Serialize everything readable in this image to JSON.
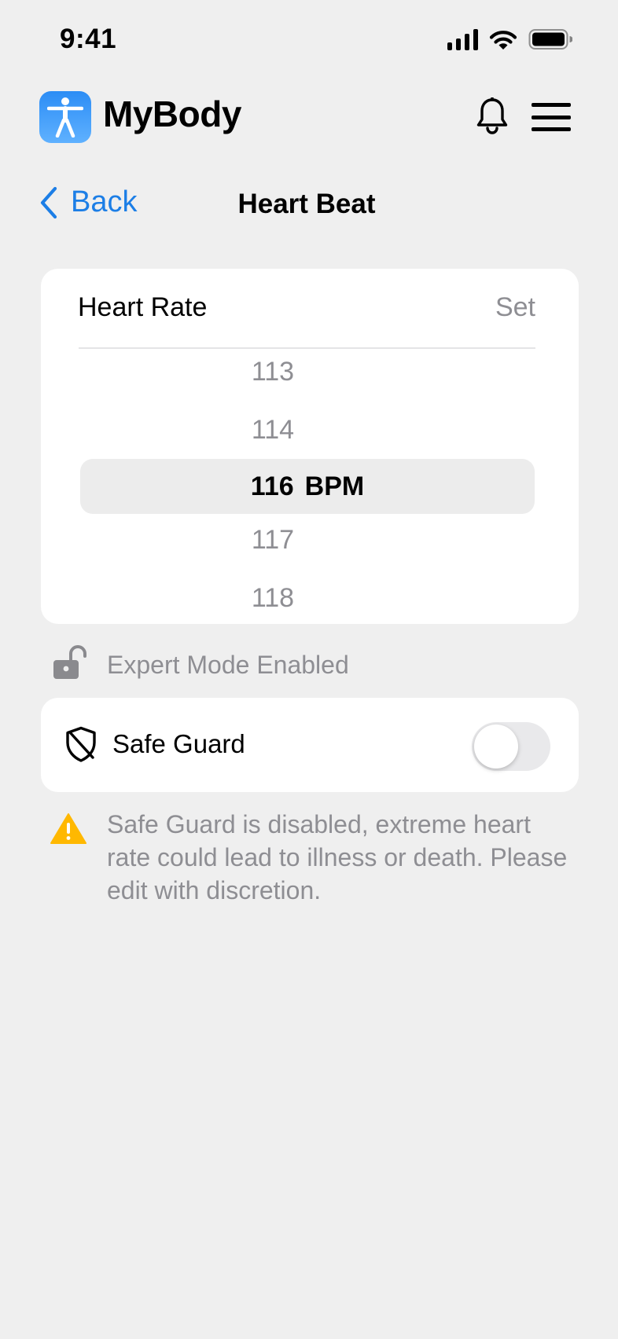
{
  "status_bar": {
    "time": "9:41"
  },
  "app": {
    "name": "MyBody"
  },
  "nav": {
    "back_label": "Back",
    "title": "Heart Beat"
  },
  "picker": {
    "label": "Heart Rate",
    "set_label": "Set",
    "items_above": [
      "113",
      "114"
    ],
    "selected_value": "116",
    "unit": "BPM",
    "items_below": [
      "117",
      "118"
    ]
  },
  "expert_mode": {
    "text": "Expert Mode Enabled"
  },
  "safe_guard": {
    "label": "Safe Guard",
    "enabled": false
  },
  "warning": {
    "text": "Safe Guard is disabled, extreme heart rate could lead to illness or death. Please edit with discretion."
  },
  "colors": {
    "accent": "#1c7ee6",
    "warning": "#ffb800",
    "background": "#efefef",
    "secondary_text": "#8e8e93"
  }
}
